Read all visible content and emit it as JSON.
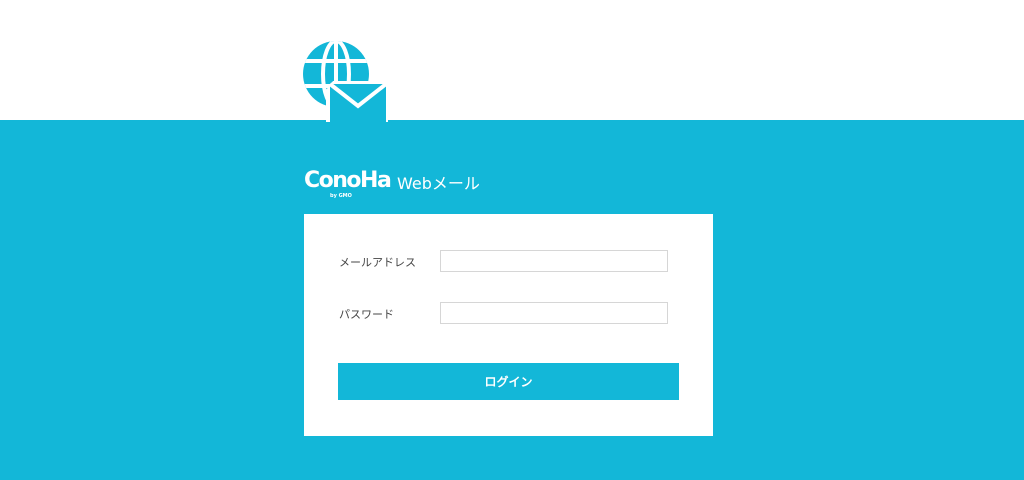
{
  "brand": {
    "logo_text": "ConoHa",
    "logo_sub": "by GMO",
    "title": "Webメール"
  },
  "login": {
    "email_label": "メールアドレス",
    "email_value": "",
    "password_label": "パスワード",
    "password_value": "",
    "submit_label": "ログイン"
  },
  "icons": {
    "app_icon": "globe-mail-icon"
  },
  "colors": {
    "accent": "#13b7d8",
    "background_top": "#ffffff",
    "card": "#ffffff",
    "input_border": "#d6d6d6",
    "label_text": "#444444"
  }
}
